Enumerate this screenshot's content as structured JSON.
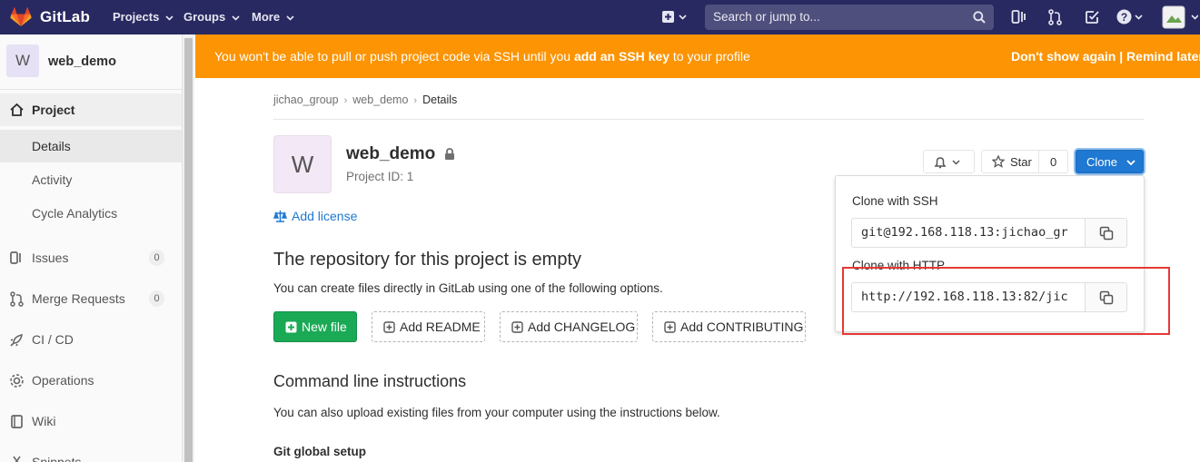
{
  "navbar": {
    "brand": "GitLab",
    "menus": [
      "Projects",
      "Groups",
      "More"
    ],
    "search_placeholder": "Search or jump to..."
  },
  "sidebar": {
    "project_avatar": "W",
    "project_name": "web_demo",
    "items": [
      {
        "label": "Project"
      },
      {
        "label": "Details"
      },
      {
        "label": "Activity"
      },
      {
        "label": "Cycle Analytics"
      },
      {
        "label": "Issues",
        "count": "0"
      },
      {
        "label": "Merge Requests",
        "count": "0"
      },
      {
        "label": "CI / CD"
      },
      {
        "label": "Operations"
      },
      {
        "label": "Wiki"
      },
      {
        "label": "Snippets"
      }
    ]
  },
  "banner": {
    "text_before": "You won't be able to pull or push project code via SSH until you ",
    "link": "add an SSH key",
    "text_after": " to your profile",
    "dont_show": "Don't show again",
    "separator": "|",
    "remind": "Remind later"
  },
  "breadcrumb": [
    "jichao_group",
    "web_demo",
    "Details"
  ],
  "project": {
    "avatar": "W",
    "title": "web_demo",
    "id_text": "Project ID: 1",
    "add_license": "Add license",
    "star_label": "Star",
    "star_count": "0",
    "clone_label": "Clone"
  },
  "empty_repo": {
    "heading": "The repository for this project is empty",
    "subtext": "You can create files directly in GitLab using one of the following options.",
    "buttons": [
      "New file",
      "Add README",
      "Add CHANGELOG",
      "Add CONTRIBUTING"
    ]
  },
  "cli": {
    "heading": "Command line instructions",
    "subtext": "You can also upload existing files from your computer using the instructions below.",
    "git_global": "Git global setup"
  },
  "clone_dropdown": {
    "ssh_label": "Clone with SSH",
    "ssh_url": "git@192.168.118.13:jichao_gr",
    "http_label": "Clone with HTTP",
    "http_url": "http://192.168.118.13:82/jic"
  },
  "colors": {
    "navbar": "#292961",
    "banner": "#fc9403",
    "primary": "#1f78d1",
    "success": "#1aaa55",
    "highlight_box": "#e53935"
  }
}
